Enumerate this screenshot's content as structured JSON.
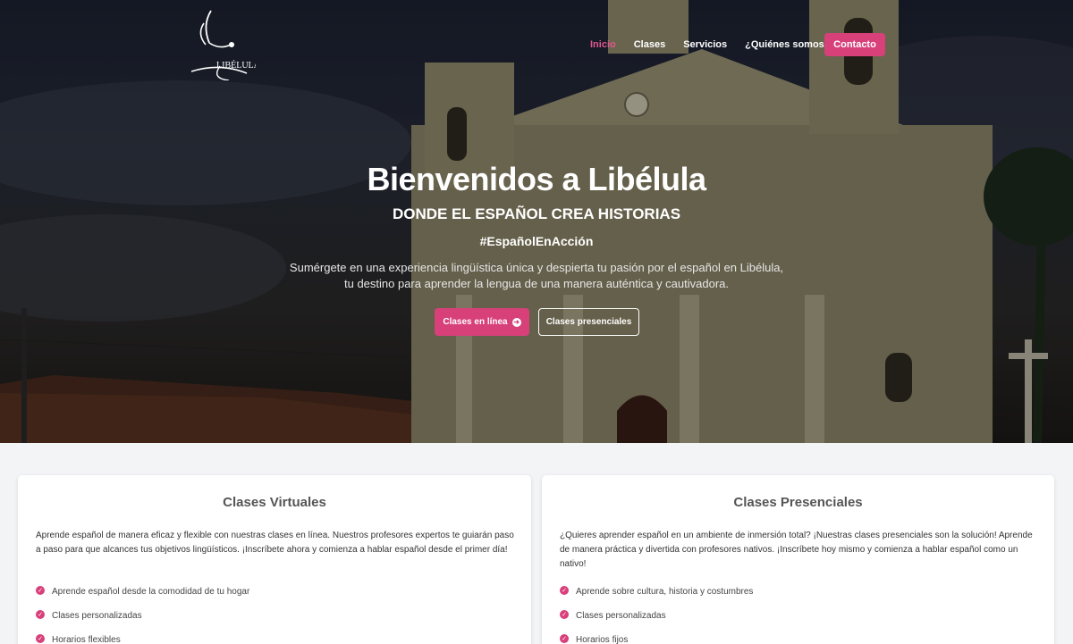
{
  "brand": {
    "accent": "#d8407a",
    "logo_text": "LIBÉLULA",
    "logo_icon": "dragonfly-icon"
  },
  "nav": {
    "items": [
      {
        "label": "Inicio",
        "active": true
      },
      {
        "label": "Clases"
      },
      {
        "label": "Servicios"
      },
      {
        "label": "¿Quiénes somos?"
      }
    ],
    "contact_label": "Contacto"
  },
  "hero": {
    "title": "Bienvenidos a Libélula",
    "subtitle": "DONDE EL ESPAÑOL CREA HISTORIAS",
    "hashtag": "#EspañolEnAcción",
    "description": "Sumérgete en una experiencia lingüística única y despierta tu pasión por el español en Libélula, tu destino para aprender la lengua de una manera auténtica y cautivadora.",
    "primary_button": "Clases en línea",
    "primary_icon": "arrow-right-circle-icon",
    "secondary_button": "Clases presenciales"
  },
  "cards": [
    {
      "title": "Clases Virtuales",
      "text": "Aprende español de manera eficaz y flexible con nuestras clases en línea. Nuestros profesores expertos te guiarán paso a paso para que alcances tus objetivos lingüísticos. ¡Inscríbete ahora y comienza a hablar español desde el primer día!",
      "items": [
        "Aprende español desde la comodidad de tu hogar",
        "Clases personalizadas",
        "Horarios flexibles"
      ]
    },
    {
      "title": "Clases Presenciales",
      "text": "¿Quieres aprender español en un ambiente de inmersión total? ¡Nuestras clases presenciales son la solución! Aprende de manera práctica y divertida con profesores nativos. ¡Inscríbete hoy mismo y comienza a hablar español como un nativo!",
      "items": [
        "Aprende sobre cultura, historia y costumbres",
        "Clases personalizadas",
        "Horarios fijos"
      ]
    }
  ]
}
